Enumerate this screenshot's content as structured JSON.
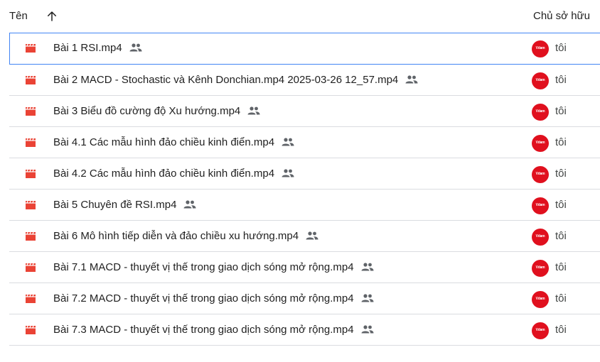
{
  "header": {
    "name_label": "Tên",
    "owner_label": "Chủ sở hữu",
    "sort_icon": "arrow-up-icon"
  },
  "colors": {
    "file_icon": "#ea4335",
    "selection_border": "#4285f4",
    "avatar_bg": "#e0101e",
    "divider": "#dadce0"
  },
  "files": [
    {
      "name": "Bài 1 RSI.mp4",
      "owner": "tôi",
      "avatar_text": "Vdam",
      "shared": true,
      "selected": true
    },
    {
      "name": "Bài 2 MACD - Stochastic và Kênh Donchian.mp4 2025-03-26 12_57.mp4",
      "owner": "tôi",
      "avatar_text": "Vdam",
      "shared": true,
      "selected": false
    },
    {
      "name": "Bài 3 Biểu đồ cường độ Xu hướng.mp4",
      "owner": "tôi",
      "avatar_text": "Vdam",
      "shared": true,
      "selected": false
    },
    {
      "name": "Bài 4.1 Các mẫu hình đảo chiều kinh điển.mp4",
      "owner": "tôi",
      "avatar_text": "Vdam",
      "shared": true,
      "selected": false
    },
    {
      "name": "Bài 4.2 Các mẫu hình đảo chiều kinh điển.mp4",
      "owner": "tôi",
      "avatar_text": "Vdam",
      "shared": true,
      "selected": false
    },
    {
      "name": "Bài 5 Chuyên đề RSI.mp4",
      "owner": "tôi",
      "avatar_text": "Vdam",
      "shared": true,
      "selected": false
    },
    {
      "name": "Bài 6 Mô hình tiếp diễn và đảo chiều xu hướng.mp4",
      "owner": "tôi",
      "avatar_text": "Vdam",
      "shared": true,
      "selected": false
    },
    {
      "name": "Bài 7.1 MACD - thuyết vị thế trong giao dịch sóng mở rộng.mp4",
      "owner": "tôi",
      "avatar_text": "Vdam",
      "shared": true,
      "selected": false
    },
    {
      "name": "Bài 7.2 MACD - thuyết vị thế trong giao dịch sóng mở rộng.mp4",
      "owner": "tôi",
      "avatar_text": "Vdam",
      "shared": true,
      "selected": false
    },
    {
      "name": "Bài 7.3 MACD - thuyết vị thế trong giao dịch sóng mở rộng.mp4",
      "owner": "tôi",
      "avatar_text": "Vdam",
      "shared": true,
      "selected": false
    }
  ]
}
